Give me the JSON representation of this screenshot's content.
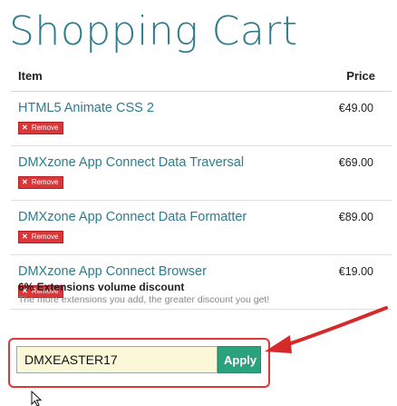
{
  "page": {
    "title": "Shopping Cart"
  },
  "table": {
    "header_item": "Item",
    "header_price": "Price",
    "items": [
      {
        "name": "HTML5 Animate CSS 2",
        "price": "€49.00",
        "remove_label": "Remove"
      },
      {
        "name": "DMXzone App Connect Data Traversal",
        "price": "€69.00",
        "remove_label": "Remove"
      },
      {
        "name": "DMXzone App Connect Data Formatter",
        "price": "€89.00",
        "remove_label": "Remove"
      },
      {
        "name": "DMXzone App Connect Browser",
        "price": "€19.00",
        "remove_label": "Remove"
      }
    ]
  },
  "discount": {
    "title": "6% Extensions volume discount",
    "subtitle": "The more extensions you add, the greater discount you get!"
  },
  "coupon": {
    "value": "DMXEASTER17",
    "apply_label": "Apply"
  },
  "colors": {
    "title": "#2e7c8c",
    "remove": "#d9383a",
    "apply": "#2aa27b",
    "highlight": "#e03838"
  },
  "icons": {
    "remove": "close-icon",
    "annotation": "red-arrow-icon",
    "pointer": "mouse-cursor-icon"
  }
}
